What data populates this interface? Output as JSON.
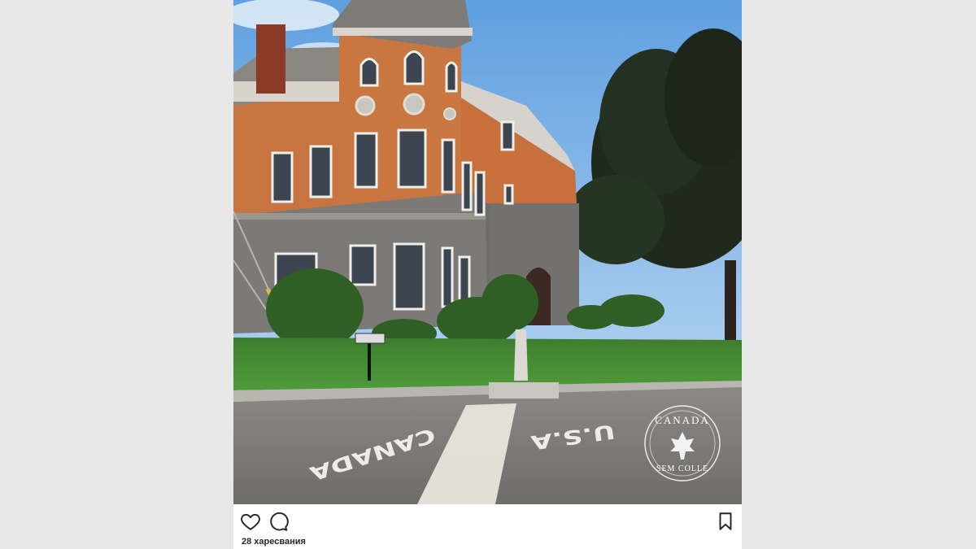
{
  "post": {
    "photo": {
      "road_markings": {
        "left": "CANADA",
        "right": "U.S.A"
      },
      "watermark": {
        "top": "CANADA",
        "bottom": "SEM COLLE"
      }
    },
    "actions": {
      "like_icon": "heart-icon",
      "comment_icon": "comment-icon",
      "save_icon": "bookmark-icon"
    },
    "likes_text": "28 харесвания"
  },
  "colors": {
    "page_bg": "#e8e8e8",
    "card_bg": "#ffffff",
    "text": "#262626"
  }
}
